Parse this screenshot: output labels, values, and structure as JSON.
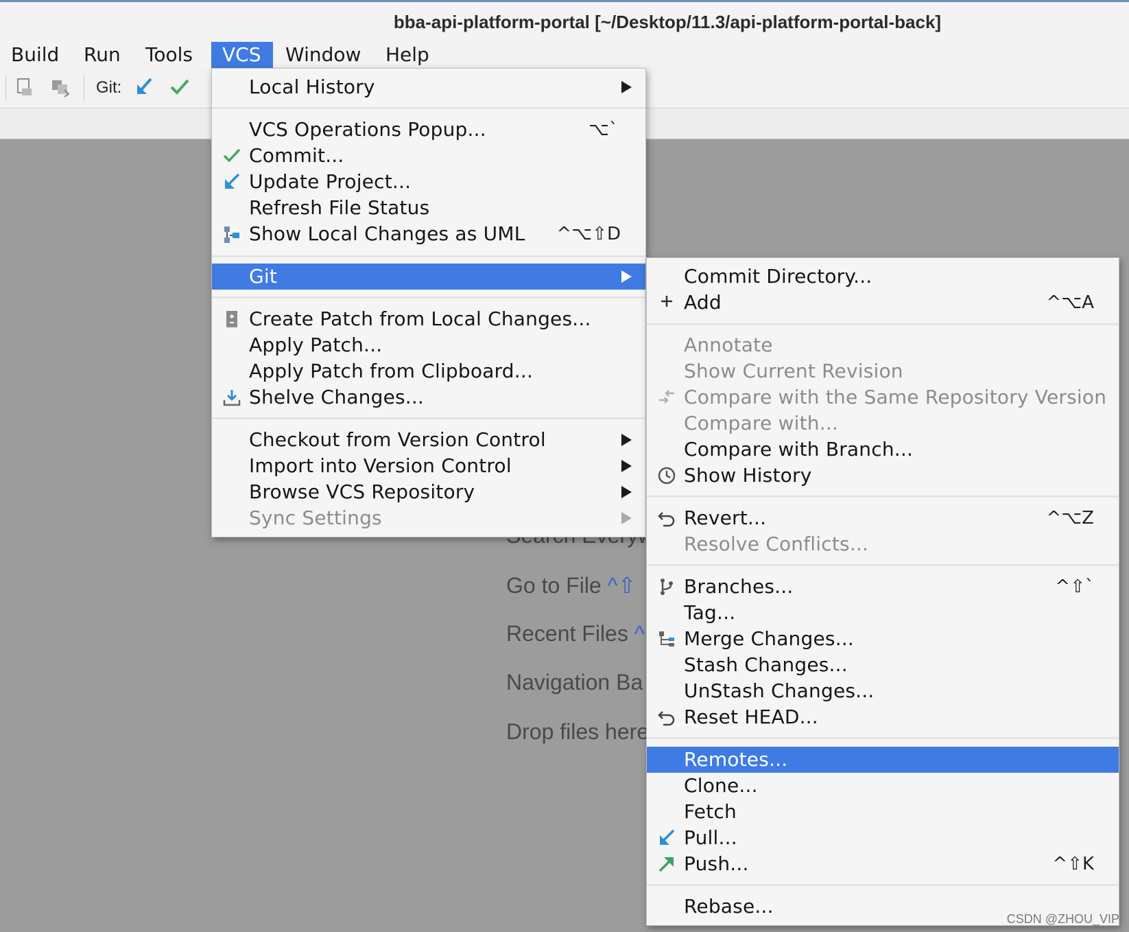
{
  "window": {
    "title": "bba-api-platform-portal [~/Desktop/11.3/api-platform-portal-back]"
  },
  "menubar": {
    "items": [
      "Build",
      "Run",
      "Tools",
      "VCS",
      "Window",
      "Help"
    ],
    "active": "VCS"
  },
  "toolbar": {
    "git_label": "Git:"
  },
  "welcome": {
    "search_everywhere": "Search Everyw",
    "go_to_file": "Go to File",
    "go_to_file_keys": "^⇧",
    "recent_files": "Recent Files",
    "recent_files_keys": "^",
    "navigation_bar": "Navigation Ba",
    "drop_files": "Drop files here"
  },
  "vcs_menu": {
    "local_history": "Local History",
    "vcs_operations_popup": "VCS Operations Popup...",
    "vcs_operations_popup_sc": "⌥`",
    "commit": "Commit...",
    "update_project": "Update Project...",
    "refresh_file_status": "Refresh File Status",
    "show_local_changes_uml": "Show Local Changes as UML",
    "show_local_changes_uml_sc": "^⌥⇧D",
    "git": "Git",
    "create_patch": "Create Patch from Local Changes...",
    "apply_patch": "Apply Patch...",
    "apply_patch_clipboard": "Apply Patch from Clipboard...",
    "shelve_changes": "Shelve Changes...",
    "checkout": "Checkout from Version Control",
    "import": "Import into Version Control",
    "browse_repo": "Browse VCS Repository",
    "sync_settings": "Sync Settings"
  },
  "git_menu": {
    "commit_directory": "Commit Directory...",
    "add": "Add",
    "add_sc": "^⌥A",
    "annotate": "Annotate",
    "show_current_revision": "Show Current Revision",
    "compare_same_repo": "Compare with the Same Repository Version",
    "compare_with": "Compare with...",
    "compare_with_branch": "Compare with Branch...",
    "show_history": "Show History",
    "revert": "Revert...",
    "revert_sc": "^⌥Z",
    "resolve_conflicts": "Resolve Conflicts...",
    "branches": "Branches...",
    "branches_sc": "^⇧`",
    "tag": "Tag...",
    "merge_changes": "Merge Changes...",
    "stash_changes": "Stash Changes...",
    "unstash_changes": "UnStash Changes...",
    "reset_head": "Reset HEAD...",
    "remotes": "Remotes...",
    "clone": "Clone...",
    "fetch": "Fetch",
    "pull": "Pull...",
    "push": "Push...",
    "push_sc": "^⇧K",
    "rebase": "Rebase..."
  },
  "watermark": "CSDN @ZHOU_VIP",
  "colors": {
    "accent": "#3f7be3",
    "check_green": "#4aa564",
    "update_blue": "#2f8fd8",
    "push_green": "#3aa56a"
  }
}
